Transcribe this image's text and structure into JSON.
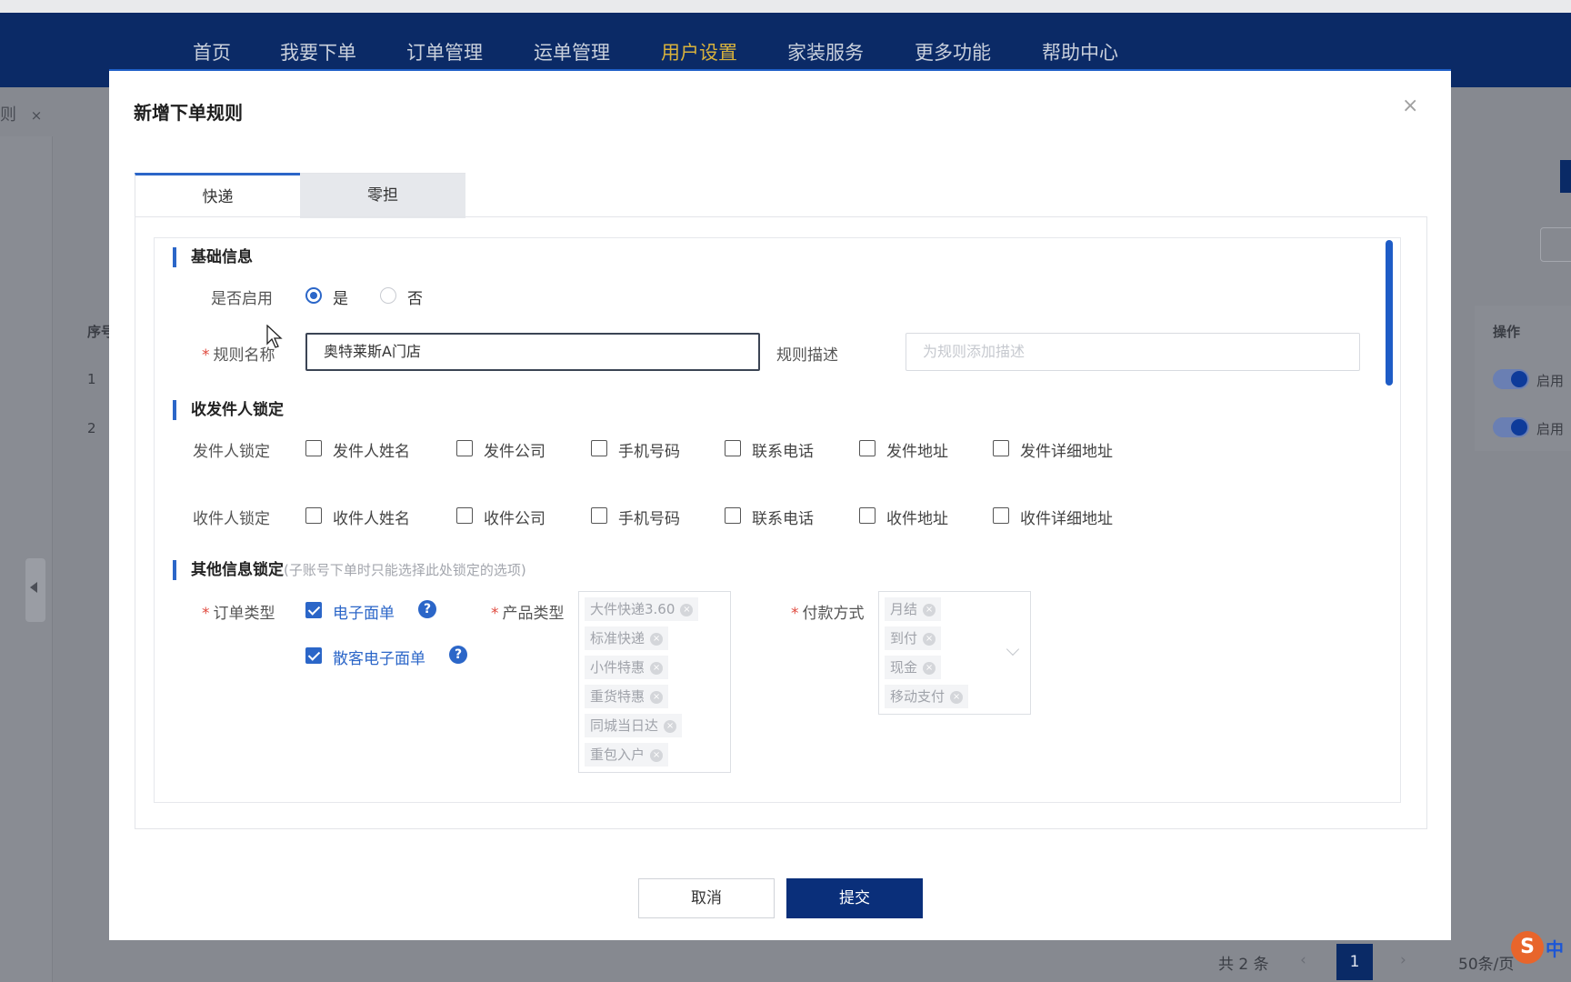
{
  "nav": {
    "items": [
      {
        "label": "首页",
        "active": false
      },
      {
        "label": "我要下单",
        "active": false
      },
      {
        "label": "订单管理",
        "active": false
      },
      {
        "label": "运单管理",
        "active": false
      },
      {
        "label": "用户设置",
        "active": true
      },
      {
        "label": "家装服务",
        "active": false
      },
      {
        "label": "更多功能",
        "active": false
      },
      {
        "label": "帮助中心",
        "active": false
      }
    ],
    "active_color": "#d8b23c"
  },
  "background": {
    "tab_fragment": "则",
    "tab_close": "×",
    "table": {
      "col_seq": "序号",
      "col_action": "操作",
      "rows": [
        {
          "num": "1",
          "status": "启用"
        },
        {
          "num": "2",
          "status": "启用"
        }
      ]
    },
    "pager": {
      "total": "共 2 条",
      "prev": "‹",
      "next": "›",
      "current_page": "1",
      "page_size": "50条/页"
    },
    "ime": {
      "logo": "S",
      "mode": "中"
    }
  },
  "modal": {
    "title": "新增下单规则",
    "close_icon": "×",
    "tabs": [
      {
        "label": "快递",
        "active": true
      },
      {
        "label": "零担",
        "active": false
      }
    ],
    "basic": {
      "title": "基础信息",
      "enable_label": "是否启用",
      "enable_yes": "是",
      "enable_no": "否",
      "enable_value": "是",
      "name_label": "规则名称",
      "name_value": "奥特莱斯A门店",
      "desc_label": "规则描述",
      "desc_placeholder": "为规则添加描述",
      "desc_value": ""
    },
    "lock": {
      "title": "收发件人锁定",
      "sender": {
        "label": "发件人锁定",
        "options": [
          "发件人姓名",
          "发件公司",
          "手机号码",
          "联系电话",
          "发件地址",
          "发件详细地址"
        ],
        "checked": [
          false,
          false,
          false,
          false,
          false,
          false
        ]
      },
      "receiver": {
        "label": "收件人锁定",
        "options": [
          "收件人姓名",
          "收件公司",
          "手机号码",
          "联系电话",
          "收件地址",
          "收件详细地址"
        ],
        "checked": [
          false,
          false,
          false,
          false,
          false,
          false
        ]
      }
    },
    "other": {
      "title": "其他信息锁定",
      "hint": "(子账号下单时只能选择此处锁定的选项)",
      "order_type": {
        "label": "订单类型",
        "options": [
          {
            "label": "电子面单",
            "checked": true
          },
          {
            "label": "散客电子面单",
            "checked": true
          }
        ],
        "help_icon": "?"
      },
      "product_type": {
        "label": "产品类型",
        "tags": [
          "大件快递3.60",
          "标准快递",
          "小件特惠",
          "重货特惠",
          "同城当日达",
          "重包入户"
        ]
      },
      "payment": {
        "label": "付款方式",
        "tags": [
          "月结",
          "到付",
          "现金",
          "移动支付"
        ]
      }
    },
    "buttons": {
      "cancel": "取消",
      "submit": "提交"
    },
    "accent_color": "#2b66c8",
    "submit_color": "#0a2f7a"
  }
}
